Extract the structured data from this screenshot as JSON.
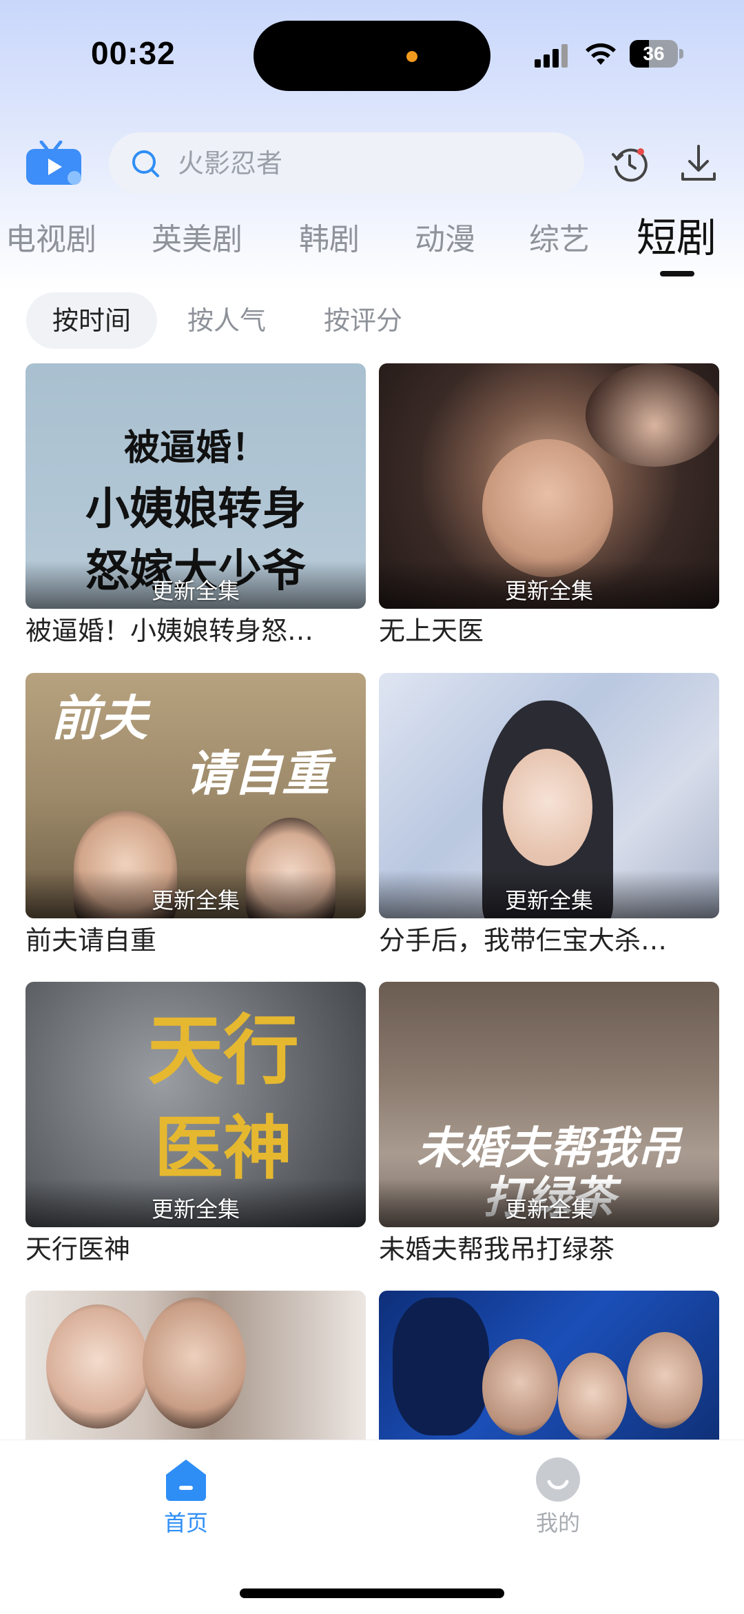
{
  "status_bar": {
    "time": "00:32",
    "battery": "36"
  },
  "header": {
    "search_placeholder": "火影忍者",
    "logo_icon": "tv-play-logo-icon",
    "history_icon": "history-icon",
    "download_icon": "download-icon"
  },
  "category_tabs": [
    {
      "label": "电视剧",
      "active": false
    },
    {
      "label": "英美剧",
      "active": false
    },
    {
      "label": "韩剧",
      "active": false
    },
    {
      "label": "动漫",
      "active": false
    },
    {
      "label": "综艺",
      "active": false
    },
    {
      "label": "短剧",
      "active": true
    }
  ],
  "sort_options": [
    {
      "label": "按时间",
      "active": true
    },
    {
      "label": "按人气",
      "active": false
    },
    {
      "label": "按评分",
      "active": false
    }
  ],
  "items": [
    {
      "title": "被逼婚！小姨娘转身怒…",
      "badge": "更新全集",
      "art_lines": [
        "被逼婚！",
        "小姨娘转身",
        "怒嫁大少爷"
      ]
    },
    {
      "title": "无上天医",
      "badge": "更新全集"
    },
    {
      "title": "前夫请自重",
      "badge": "更新全集",
      "art_lines": [
        "前夫",
        "请自重"
      ]
    },
    {
      "title": "分手后，我带仨宝大杀…",
      "badge": "更新全集"
    },
    {
      "title": "天行医神",
      "badge": "更新全集",
      "art_lines": [
        "天行",
        "医神"
      ]
    },
    {
      "title": "未婚夫帮我吊打绿茶",
      "badge": "更新全集",
      "art_lines": [
        "未婚夫帮我吊",
        "打绿茶"
      ]
    },
    {
      "title": "",
      "badge": ""
    },
    {
      "title": "",
      "badge": ""
    }
  ],
  "bottom_nav": [
    {
      "label": "首页",
      "icon": "home-icon",
      "active": true
    },
    {
      "label": "我的",
      "icon": "profile-icon",
      "active": false
    }
  ],
  "colors": {
    "accent": "#2f8ef6",
    "active_text": "#111111",
    "inactive_text": "#8e9299"
  }
}
